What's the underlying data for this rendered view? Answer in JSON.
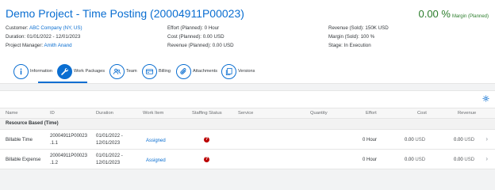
{
  "header": {
    "title": "Demo Project - Time Posting (20004911P00023)",
    "kpi": {
      "value": "0.00 %",
      "label": "Margin (Planned)",
      "color": "#2b7d2b"
    },
    "col1": {
      "customer_label": "Customer:",
      "customer_value": "ABC Company (NY, US)",
      "duration_label": "Duration:",
      "duration_value": "01/01/2022 - 12/01/2023",
      "pm_label": "Project Manager:",
      "pm_value": "Amith Anand"
    },
    "col2": {
      "effort": "Effort (Planned): 0 Hour",
      "cost": "Cost (Planned): 0.00 USD",
      "revenue": "Revenue (Planned): 0.00 USD"
    },
    "col3": {
      "revenue_sold": "Revenue (Sold): 150K USD",
      "margin_sold": "Margin (Sold): 100 %",
      "stage": "Stage: In Execution"
    }
  },
  "tabs": [
    {
      "label": "Information",
      "icon": "info-icon"
    },
    {
      "label": "Work Packages",
      "icon": "wrench-icon",
      "active": true
    },
    {
      "label": "Team",
      "icon": "team-icon"
    },
    {
      "label": "Billing",
      "icon": "billing-icon"
    },
    {
      "label": "Attachments",
      "icon": "paperclip-icon"
    },
    {
      "label": "Versions",
      "icon": "versions-icon"
    }
  ],
  "table": {
    "columns": [
      "Name",
      "ID",
      "Duration",
      "Work Item",
      "Staffing Status",
      "Service",
      "Quantity",
      "Effort",
      "Cost",
      "Revenue"
    ],
    "group": "Resource Based (Time)",
    "rows": [
      {
        "name": "Billable Time",
        "id_line1": "20004911P00023",
        "id_line2": ".1.1",
        "dur_line1": "01/01/2022 -",
        "dur_line2": "12/01/2023",
        "work_item": "Assigned",
        "staffing": "?",
        "effort": "0 Hour",
        "cost": "0.00",
        "cost_unit": "USD",
        "revenue": "0.00",
        "revenue_unit": "USD"
      },
      {
        "name": "Billable Expense",
        "id_line1": "20004911P00023",
        "id_line2": ".1.2",
        "dur_line1": "01/01/2022 -",
        "dur_line2": "12/01/2023",
        "work_item": "Assigned",
        "staffing": "?",
        "effort": "0 Hour",
        "cost": "0.00",
        "cost_unit": "USD",
        "revenue": "0.00",
        "revenue_unit": "USD"
      }
    ]
  },
  "colors": {
    "accent": "#0a6ed1",
    "error": "#bb0000"
  }
}
